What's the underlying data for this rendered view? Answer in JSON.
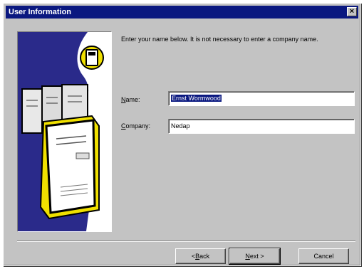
{
  "window": {
    "title": "User Information",
    "close_label": "×"
  },
  "instructions": "Enter your name below. It is not necessary to enter a company name.",
  "form": {
    "name_label_prefix": "N",
    "name_label_rest": "ame:",
    "name_value": "Ernst Wormwood",
    "company_label_prefix": "C",
    "company_label_rest": "ompany:",
    "company_value": "Nedap"
  },
  "buttons": {
    "back_prefix": "< ",
    "back_hotkey": "B",
    "back_rest": "ack",
    "next_hotkey": "N",
    "next_rest": "ext >",
    "cancel": "Cancel"
  },
  "colors": {
    "titlebar": "#0a1880",
    "dialog_face": "#c3c3c3",
    "illustration_blue": "#2a2a8a",
    "illustration_yellow": "#f0e000"
  },
  "icons": [
    "close-icon",
    "disk-icon",
    "computer-icon"
  ]
}
